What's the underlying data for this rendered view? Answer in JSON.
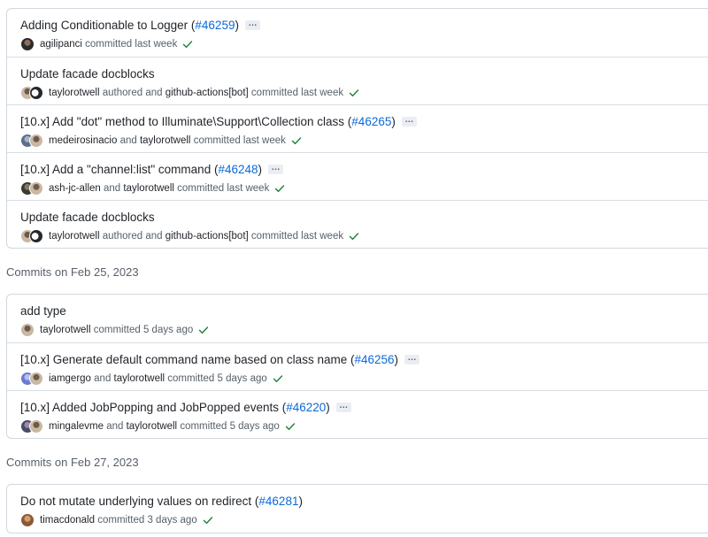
{
  "colors": {
    "link": "#0969da",
    "check": "#1a7f37",
    "border": "#d0d7de",
    "muted": "#57606a"
  },
  "groups": [
    {
      "heading": "",
      "commits": [
        {
          "title": "Adding Conditionable to Logger",
          "pr": "#46259",
          "has_ellipsis": true,
          "avatars": [
            "agilipanci"
          ],
          "meta": [
            {
              "type": "author",
              "text": "agilipanci"
            },
            {
              "type": "text",
              "text": "committed last week"
            }
          ]
        },
        {
          "title": "Update facade docblocks",
          "pr": "",
          "has_ellipsis": false,
          "avatars": [
            "taylorotwell",
            "github-actions[bot]"
          ],
          "meta": [
            {
              "type": "author",
              "text": "taylorotwell"
            },
            {
              "type": "text",
              "text": "authored and"
            },
            {
              "type": "author",
              "text": "github-actions[bot]"
            },
            {
              "type": "text",
              "text": "committed last week"
            }
          ]
        },
        {
          "title": "[10.x] Add \"dot\" method to Illuminate\\Support\\Collection class",
          "pr": "#46265",
          "has_ellipsis": true,
          "avatars": [
            "medeirosinacio",
            "taylorotwell"
          ],
          "meta": [
            {
              "type": "author",
              "text": "medeirosinacio"
            },
            {
              "type": "text",
              "text": "and"
            },
            {
              "type": "author",
              "text": "taylorotwell"
            },
            {
              "type": "text",
              "text": "committed last week"
            }
          ]
        },
        {
          "title": "[10.x] Add a \"channel:list\" command",
          "pr": "#46248",
          "has_ellipsis": true,
          "avatars": [
            "ash-jc-allen",
            "taylorotwell"
          ],
          "meta": [
            {
              "type": "author",
              "text": "ash-jc-allen"
            },
            {
              "type": "text",
              "text": "and"
            },
            {
              "type": "author",
              "text": "taylorotwell"
            },
            {
              "type": "text",
              "text": "committed last week"
            }
          ]
        },
        {
          "title": "Update facade docblocks",
          "pr": "",
          "has_ellipsis": false,
          "avatars": [
            "taylorotwell",
            "github-actions[bot]"
          ],
          "meta": [
            {
              "type": "author",
              "text": "taylorotwell"
            },
            {
              "type": "text",
              "text": "authored and"
            },
            {
              "type": "author",
              "text": "github-actions[bot]"
            },
            {
              "type": "text",
              "text": "committed last week"
            }
          ]
        }
      ]
    },
    {
      "heading": "Commits on Feb 25, 2023",
      "commits": [
        {
          "title": "add type",
          "pr": "",
          "has_ellipsis": false,
          "avatars": [
            "taylorotwell"
          ],
          "meta": [
            {
              "type": "author",
              "text": "taylorotwell"
            },
            {
              "type": "text",
              "text": "committed 5 days ago"
            }
          ]
        },
        {
          "title": "[10.x] Generate default command name based on class name",
          "pr": "#46256",
          "has_ellipsis": true,
          "avatars": [
            "iamgergo",
            "taylorotwell"
          ],
          "meta": [
            {
              "type": "author",
              "text": "iamgergo"
            },
            {
              "type": "text",
              "text": "and"
            },
            {
              "type": "author",
              "text": "taylorotwell"
            },
            {
              "type": "text",
              "text": "committed 5 days ago"
            }
          ]
        },
        {
          "title": "[10.x] Added JobPopping and JobPopped events",
          "pr": "#46220",
          "has_ellipsis": true,
          "avatars": [
            "mingalevme",
            "taylorotwell"
          ],
          "meta": [
            {
              "type": "author",
              "text": "mingalevme"
            },
            {
              "type": "text",
              "text": "and"
            },
            {
              "type": "author",
              "text": "taylorotwell"
            },
            {
              "type": "text",
              "text": "committed 5 days ago"
            }
          ]
        }
      ]
    },
    {
      "heading": "Commits on Feb 27, 2023",
      "commits": [
        {
          "title": "Do not mutate underlying values on redirect",
          "pr": "#46281",
          "has_ellipsis": false,
          "avatars": [
            "timacdonald"
          ],
          "meta": [
            {
              "type": "author",
              "text": "timacdonald"
            },
            {
              "type": "text",
              "text": "committed 3 days ago"
            }
          ]
        }
      ]
    }
  ]
}
